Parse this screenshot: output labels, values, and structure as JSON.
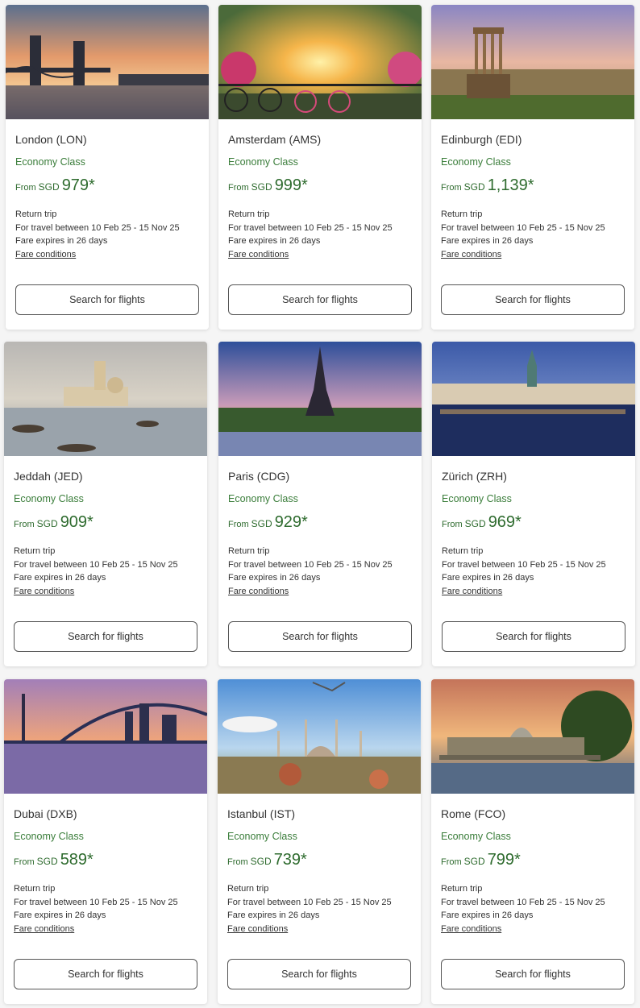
{
  "cards": [
    {
      "city": "London (LON)",
      "cabin": "Economy Class",
      "from": "From",
      "currency": "SGD",
      "price": "979*",
      "trip": "Return trip",
      "travel": "For travel between 10 Feb 25 - 15 Nov 25",
      "expires": "Fare expires in 26 days",
      "conditions": "Fare conditions",
      "button": "Search for flights"
    },
    {
      "city": "Amsterdam (AMS)",
      "cabin": "Economy Class",
      "from": "From",
      "currency": "SGD",
      "price": "999*",
      "trip": "Return trip",
      "travel": "For travel between 10 Feb 25 - 15 Nov 25",
      "expires": "Fare expires in 26 days",
      "conditions": "Fare conditions",
      "button": "Search for flights"
    },
    {
      "city": "Edinburgh (EDI)",
      "cabin": "Economy Class",
      "from": "From",
      "currency": "SGD",
      "price": "1,139*",
      "trip": "Return trip",
      "travel": "For travel between 10 Feb 25 - 15 Nov 25",
      "expires": "Fare expires in 26 days",
      "conditions": "Fare conditions",
      "button": "Search for flights"
    },
    {
      "city": "Jeddah (JED)",
      "cabin": "Economy Class",
      "from": "From",
      "currency": "SGD",
      "price": "909*",
      "trip": "Return trip",
      "travel": "For travel between 10 Feb 25 - 15 Nov 25",
      "expires": "Fare expires in 26 days",
      "conditions": "Fare conditions",
      "button": "Search for flights"
    },
    {
      "city": "Paris (CDG)",
      "cabin": "Economy Class",
      "from": "From",
      "currency": "SGD",
      "price": "929*",
      "trip": "Return trip",
      "travel": "For travel between 10 Feb 25 - 15 Nov 25",
      "expires": "Fare expires in 26 days",
      "conditions": "Fare conditions",
      "button": "Search for flights"
    },
    {
      "city": "Zürich (ZRH)",
      "cabin": "Economy Class",
      "from": "From",
      "currency": "SGD",
      "price": "969*",
      "trip": "Return trip",
      "travel": "For travel between 10 Feb 25 - 15 Nov 25",
      "expires": "Fare expires in 26 days",
      "conditions": "Fare conditions",
      "button": "Search for flights"
    },
    {
      "city": "Dubai (DXB)",
      "cabin": "Economy Class",
      "from": "From",
      "currency": "SGD",
      "price": "589*",
      "trip": "Return trip",
      "travel": "For travel between 10 Feb 25 - 15 Nov 25",
      "expires": "Fare expires in 26 days",
      "conditions": "Fare conditions",
      "button": "Search for flights"
    },
    {
      "city": "Istanbul (IST)",
      "cabin": "Economy Class",
      "from": "From",
      "currency": "SGD",
      "price": "739*",
      "trip": "Return trip",
      "travel": "For travel between 10 Feb 25 - 15 Nov 25",
      "expires": "Fare expires in 26 days",
      "conditions": "Fare conditions",
      "button": "Search for flights"
    },
    {
      "city": "Rome (FCO)",
      "cabin": "Economy Class",
      "from": "From",
      "currency": "SGD",
      "price": "799*",
      "trip": "Return trip",
      "travel": "For travel between 10 Feb 25 - 15 Nov 25",
      "expires": "Fare expires in 26 days",
      "conditions": "Fare conditions",
      "button": "Search for flights"
    }
  ],
  "colors": {
    "accent_green": "#2e6b2e",
    "cabin_green": "#3a7d3a"
  }
}
